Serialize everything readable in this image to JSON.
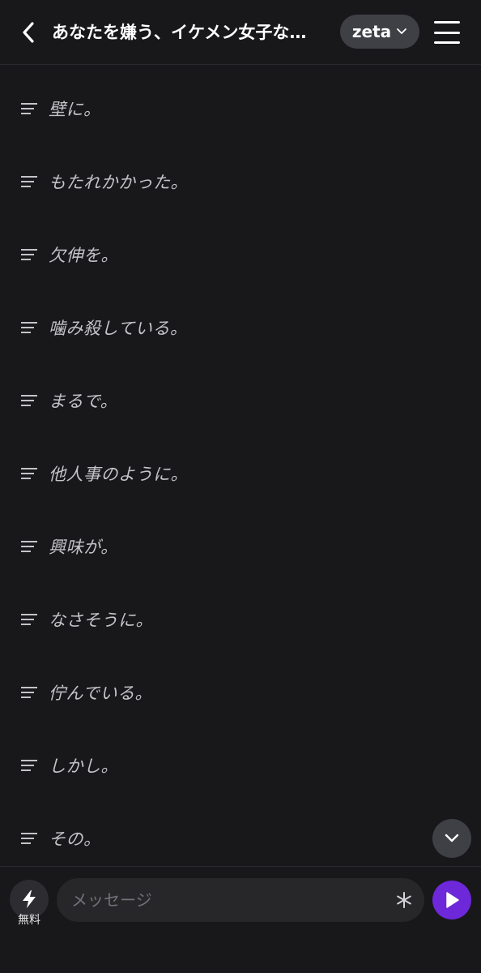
{
  "header": {
    "title": "あなたを嫌う、イケメン女子な…",
    "model": "zeta",
    "icons": {
      "back": "chevron-left-icon",
      "model_dropdown": "chevron-down-icon",
      "menu": "hamburger-menu-icon"
    }
  },
  "messages": [
    {
      "text": "壁に。"
    },
    {
      "text": "もたれかかった。"
    },
    {
      "text": "欠伸を。"
    },
    {
      "text": "噛み殺している。"
    },
    {
      "text": "まるで。"
    },
    {
      "text": "他人事のように。"
    },
    {
      "text": "興味が。"
    },
    {
      "text": "なさそうに。"
    },
    {
      "text": "佇んでいる。"
    },
    {
      "text": "しかし。"
    },
    {
      "text": "その。"
    }
  ],
  "composer": {
    "boost_label": "無料",
    "placeholder": "メッセージ",
    "icons": {
      "boost": "lightning-icon",
      "special": "asterisk-icon",
      "send": "play-send-icon",
      "scroll": "chevron-down-icon"
    }
  },
  "colors": {
    "background": "#18181b",
    "accent": "#6d28d9",
    "pill": "#3f3f46",
    "input": "#27272a"
  }
}
